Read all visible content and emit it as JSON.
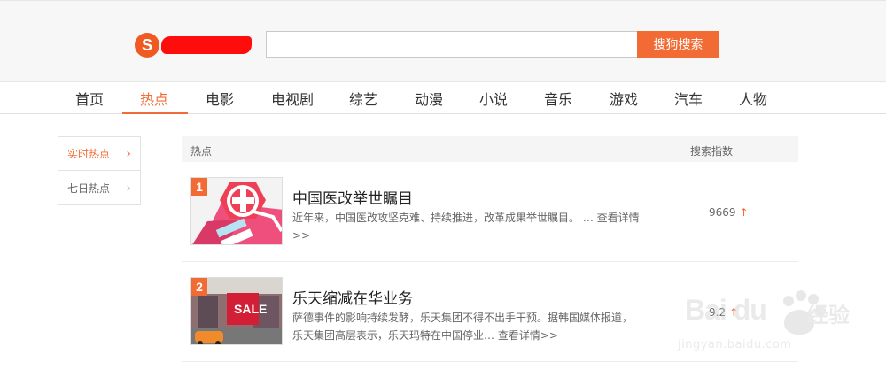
{
  "header": {
    "logo_letter": "S",
    "search_value": "",
    "search_button": "搜狗搜索",
    "logo_icon": "sogou-logo-icon"
  },
  "nav": {
    "items": [
      {
        "label": "首页"
      },
      {
        "label": "热点"
      },
      {
        "label": "电影"
      },
      {
        "label": "电视剧"
      },
      {
        "label": "综艺"
      },
      {
        "label": "动漫"
      },
      {
        "label": "小说"
      },
      {
        "label": "音乐"
      },
      {
        "label": "游戏"
      },
      {
        "label": "汽车"
      },
      {
        "label": "人物"
      }
    ],
    "active": "热点"
  },
  "sidebar": {
    "items": [
      {
        "label": "实时热点",
        "chevron": "›"
      },
      {
        "label": "七日热点",
        "chevron": "›"
      }
    ]
  },
  "list": {
    "header_left": "热点",
    "header_right": "搜索指数",
    "rows": [
      {
        "rank": "1",
        "title": "中国医改举世瞩目",
        "desc": "近年来，中国医改攻坚克难、持续推进，改革成果举世瞩目。 …",
        "more": "查看详情>>",
        "index": "9669",
        "arrow": "↑"
      },
      {
        "rank": "2",
        "title": "乐天缩减在华业务",
        "desc": "萨德事件的影响持续发酵，乐天集团不得不出手干预。据韩国媒体报道，乐天集团高层表示，乐天玛特在中国停业…",
        "more": "查看详情>>",
        "index": "9.2",
        "arrow": "↑"
      }
    ]
  },
  "watermark": {
    "text": "Bai du",
    "cn": "经验",
    "url": "jingyan.baidu.com"
  },
  "colors": {
    "accent": "#f36b34",
    "logo_red": "#ff0000"
  }
}
